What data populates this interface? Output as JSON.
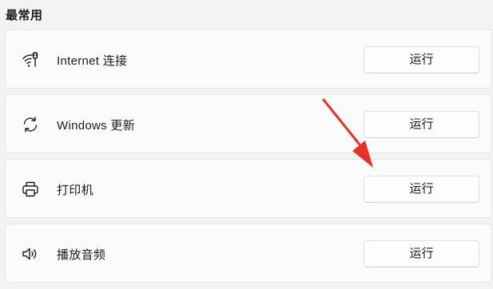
{
  "section": {
    "title": "最常用"
  },
  "rows": [
    {
      "label": "Internet 连接",
      "icon": "wifi-icon",
      "button_label": "运行"
    },
    {
      "label": "Windows 更新",
      "icon": "sync-icon",
      "button_label": "运行"
    },
    {
      "label": "打印机",
      "icon": "printer-icon",
      "button_label": "运行"
    },
    {
      "label": "播放音频",
      "icon": "speaker-icon",
      "button_label": "运行"
    }
  ],
  "annotation": {
    "type": "red-arrow",
    "color": "#e8302a",
    "points_to": "printer run button"
  },
  "colors": {
    "background": "#f3f3f3",
    "card": "#fbfbfb",
    "arrow": "#e8302a"
  }
}
